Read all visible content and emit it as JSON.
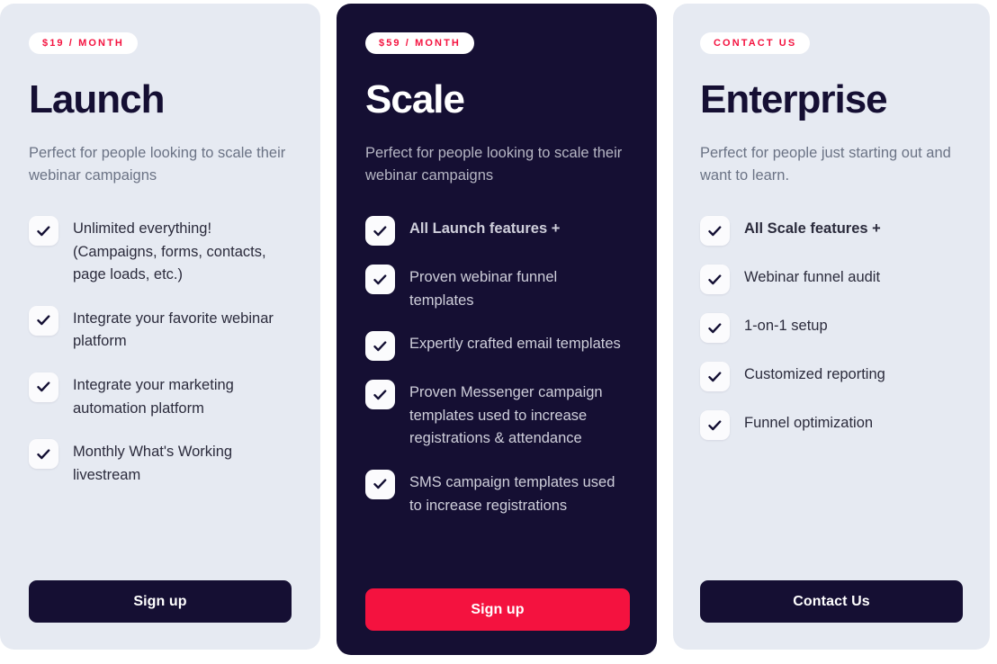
{
  "theme": {
    "card_light_bg": "#e6eaf2",
    "card_dark_bg": "#150f33",
    "accent_red": "#f4123f",
    "navy": "#150f33",
    "page_bg": "#ffffff"
  },
  "plans": [
    {
      "id": "launch",
      "badge": "$19 / MONTH",
      "title": "Launch",
      "description": "Perfect for people looking to scale their webinar campaigns",
      "features": [
        {
          "text": "Unlimited everything! (Campaigns, forms, contacts, page loads, etc.)",
          "style": "normal",
          "icon": "check-icon"
        },
        {
          "text": "Integrate your favorite webinar platform",
          "style": "normal",
          "icon": "check-icon"
        },
        {
          "text": "Integrate your marketing automation platform",
          "style": "normal",
          "icon": "check-icon"
        },
        {
          "text": "Monthly What's Working livestream",
          "style": "normal",
          "icon": "check-icon"
        }
      ],
      "cta": {
        "label": "Sign up",
        "style": "dark"
      }
    },
    {
      "id": "scale",
      "badge": "$59 / MONTH",
      "title": "Scale",
      "description": "Perfect for people looking to scale their webinar campaigns",
      "features": [
        {
          "text": "All Launch features +",
          "style": "accent-red",
          "icon": "check-icon"
        },
        {
          "text": "Proven webinar funnel templates",
          "style": "normal",
          "icon": "check-icon"
        },
        {
          "text": "Expertly crafted email templates",
          "style": "normal",
          "icon": "check-icon"
        },
        {
          "text": "Proven Messenger campaign templates used to increase registrations & attendance",
          "style": "normal",
          "icon": "check-icon"
        },
        {
          "text": "SMS campaign templates used to increase registrations",
          "style": "normal",
          "icon": "check-icon"
        }
      ],
      "cta": {
        "label": "Sign up",
        "style": "red"
      }
    },
    {
      "id": "enterprise",
      "badge": "CONTACT US",
      "title": "Enterprise",
      "description": "Perfect for people just starting out and want to learn.",
      "features": [
        {
          "text": "All Scale features +",
          "style": "accent-dark",
          "icon": "check-icon"
        },
        {
          "text": "Webinar funnel audit",
          "style": "normal",
          "icon": "check-icon"
        },
        {
          "text": "1-on-1 setup",
          "style": "normal",
          "icon": "check-icon"
        },
        {
          "text": "Customized reporting",
          "style": "normal",
          "icon": "check-icon"
        },
        {
          "text": "Funnel optimization",
          "style": "normal",
          "icon": "check-icon"
        }
      ],
      "cta": {
        "label": "Contact Us",
        "style": "dark"
      }
    }
  ]
}
